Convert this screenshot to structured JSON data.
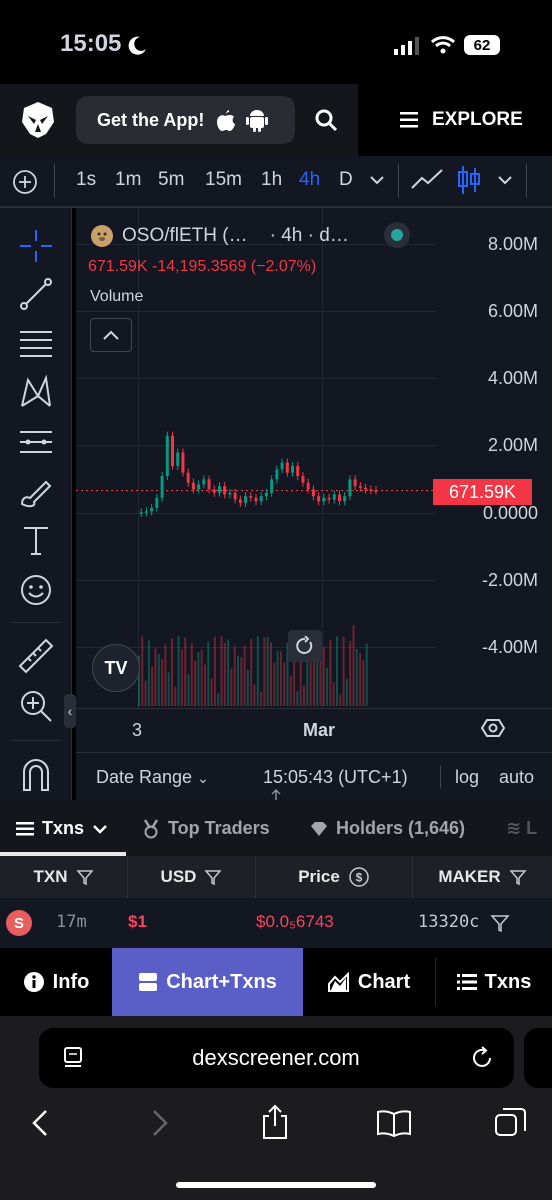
{
  "status_bar": {
    "time": "15:05",
    "battery": "62"
  },
  "header": {
    "get_app": "Get the App!",
    "explore": "EXPLORE"
  },
  "toolbar": {
    "intervals": [
      "1s",
      "1m",
      "5m",
      "15m",
      "1h",
      "4h",
      "D"
    ],
    "active_interval": "4h"
  },
  "chart": {
    "symbol": "OSO/flETH (…",
    "symbol_interval": "· 4h · d…",
    "price_line": "671.59K  -14,195.3569 (−2.07%)",
    "volume_label": "Volume",
    "price_badge": "671.59K",
    "y_ticks": [
      "8.00M",
      "6.00M",
      "4.00M",
      "2.00M",
      "0.0000",
      "-2.00M",
      "-4.00M"
    ],
    "x_ticks": [
      "3",
      "Mar"
    ],
    "date_range": "Date Range",
    "clock": "15:05:43 (UTC+1)",
    "log": "log",
    "auto": "auto"
  },
  "chart_data": {
    "type": "line",
    "series": [
      {
        "values": [
          0.0,
          0.02,
          0.05,
          0.15,
          0.45,
          1.1,
          2.3,
          1.4,
          1.8,
          1.2,
          0.9,
          0.7,
          0.85,
          1.0,
          0.7,
          0.6,
          0.8,
          0.55,
          0.6,
          0.4,
          0.3,
          0.5,
          0.45,
          0.35,
          0.5,
          0.6,
          1.0,
          1.3,
          1.5,
          1.2,
          1.4,
          1.1,
          0.9,
          0.7,
          0.5,
          0.35,
          0.45,
          0.4,
          0.55,
          0.35,
          0.5,
          1.0,
          0.8,
          0.75,
          0.7,
          0.68,
          0.67
        ]
      }
    ],
    "ylim": [
      -5,
      8.5
    ]
  },
  "tabs": {
    "txns": "Txns",
    "top_traders": "Top Traders",
    "holders": "Holders (1,646)"
  },
  "table": {
    "headers": [
      "TXN",
      "USD",
      "Price",
      "MAKER"
    ],
    "row": {
      "type": "S",
      "age": "17m",
      "usd": "$1",
      "price": "$0.0₅6743",
      "maker": "13320c"
    }
  },
  "bottom_nav": {
    "info": "Info",
    "chart_txns": "Chart+Txns",
    "chart": "Chart",
    "txns": "Txns"
  },
  "safari": {
    "url": "dexscreener.com"
  },
  "colors": {
    "accent": "#2962ff",
    "down": "#f23645",
    "up": "#089981",
    "active_tab": "#5a5fc8"
  }
}
